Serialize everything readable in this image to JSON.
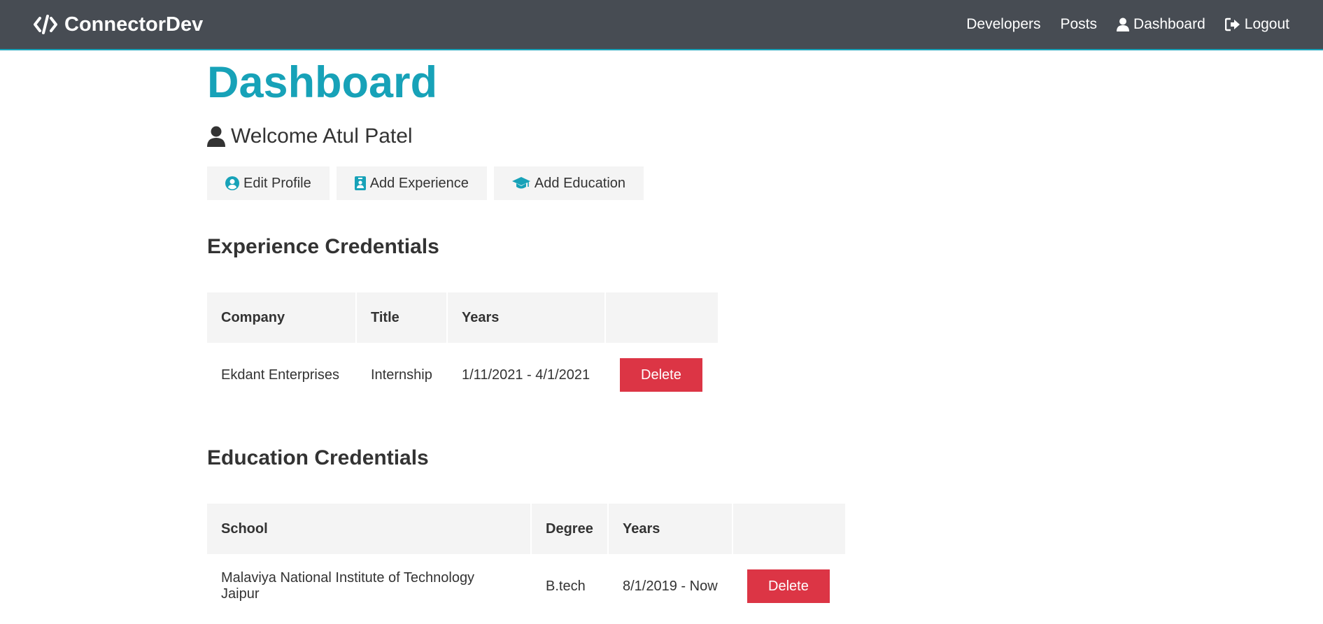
{
  "navbar": {
    "brand": "ConnectorDev",
    "links": {
      "developers": "Developers",
      "posts": "Posts",
      "dashboard": "Dashboard",
      "logout": "Logout"
    }
  },
  "main": {
    "title": "Dashboard",
    "welcome": "Welcome Atul Patel",
    "buttons": {
      "edit_profile": "Edit Profile",
      "add_experience": "Add Experience",
      "add_education": "Add Education"
    }
  },
  "experience": {
    "title": "Experience Credentials",
    "headers": [
      "Company",
      "Title",
      "Years",
      ""
    ],
    "rows": [
      {
        "company": "Ekdant Enterprises",
        "title": "Internship",
        "years": "1/11/2021 - 4/1/2021",
        "action": "Delete"
      }
    ]
  },
  "education": {
    "title": "Education Credentials",
    "headers": [
      "School",
      "Degree",
      "Years",
      ""
    ],
    "rows": [
      {
        "school": "Malaviya National Institute of Technology Jaipur",
        "degree": "B.tech",
        "years": "8/1/2019 - Now",
        "action": "Delete"
      }
    ]
  },
  "icons": {
    "brand": "code-icon",
    "dashboard": "user-icon",
    "logout": "sign-out-icon",
    "welcome": "user-icon",
    "edit_profile": "user-circle-icon",
    "add_experience": "id-badge-icon",
    "add_education": "graduation-cap-icon"
  },
  "colors": {
    "navbar": "#474c53",
    "primary": "#17a2b8",
    "danger": "#dc3545",
    "light": "#f4f4f4",
    "text": "#333333"
  }
}
